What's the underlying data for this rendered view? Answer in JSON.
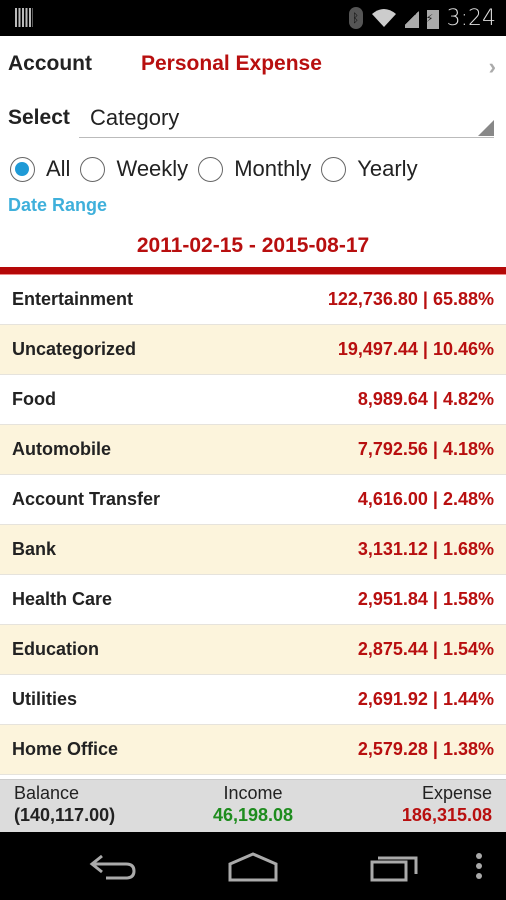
{
  "status_bar": {
    "time": "3:24"
  },
  "account": {
    "label": "Account",
    "value": "Personal Expense"
  },
  "select": {
    "label": "Select",
    "value": "Category"
  },
  "period_options": [
    {
      "label": "All",
      "checked": true
    },
    {
      "label": "Weekly",
      "checked": false
    },
    {
      "label": "Monthly",
      "checked": false
    },
    {
      "label": "Yearly",
      "checked": false
    }
  ],
  "date_range": {
    "label": "Date Range",
    "value": "2011-02-15 - 2015-08-17"
  },
  "categories": [
    {
      "name": "Entertainment",
      "amount": "122,736.80 | 65.88%"
    },
    {
      "name": "Uncategorized",
      "amount": "19,497.44 | 10.46%"
    },
    {
      "name": "Food",
      "amount": "8,989.64 | 4.82%"
    },
    {
      "name": "Automobile",
      "amount": "7,792.56 | 4.18%"
    },
    {
      "name": "Account Transfer",
      "amount": "4,616.00 | 2.48%"
    },
    {
      "name": "Bank",
      "amount": "3,131.12 | 1.68%"
    },
    {
      "name": "Health Care",
      "amount": "2,951.84 | 1.58%"
    },
    {
      "name": "Education",
      "amount": "2,875.44 | 1.54%"
    },
    {
      "name": "Utilities",
      "amount": "2,691.92 | 1.44%"
    },
    {
      "name": "Home Office",
      "amount": "2,579.28 | 1.38%"
    }
  ],
  "summary": {
    "balance": {
      "label": "Balance",
      "value": "(140,117.00)"
    },
    "income": {
      "label": "Income",
      "value": "46,198.08"
    },
    "expense": {
      "label": "Expense",
      "value": "186,315.08"
    }
  },
  "colors": {
    "accent_red": "#b80f0f",
    "income_green": "#1e8c1e",
    "expense_red": "#b80f0f",
    "date_label_blue": "#3fb0db",
    "radio_blue": "#1f9ad6",
    "alt_row": "#fcf4dc"
  }
}
